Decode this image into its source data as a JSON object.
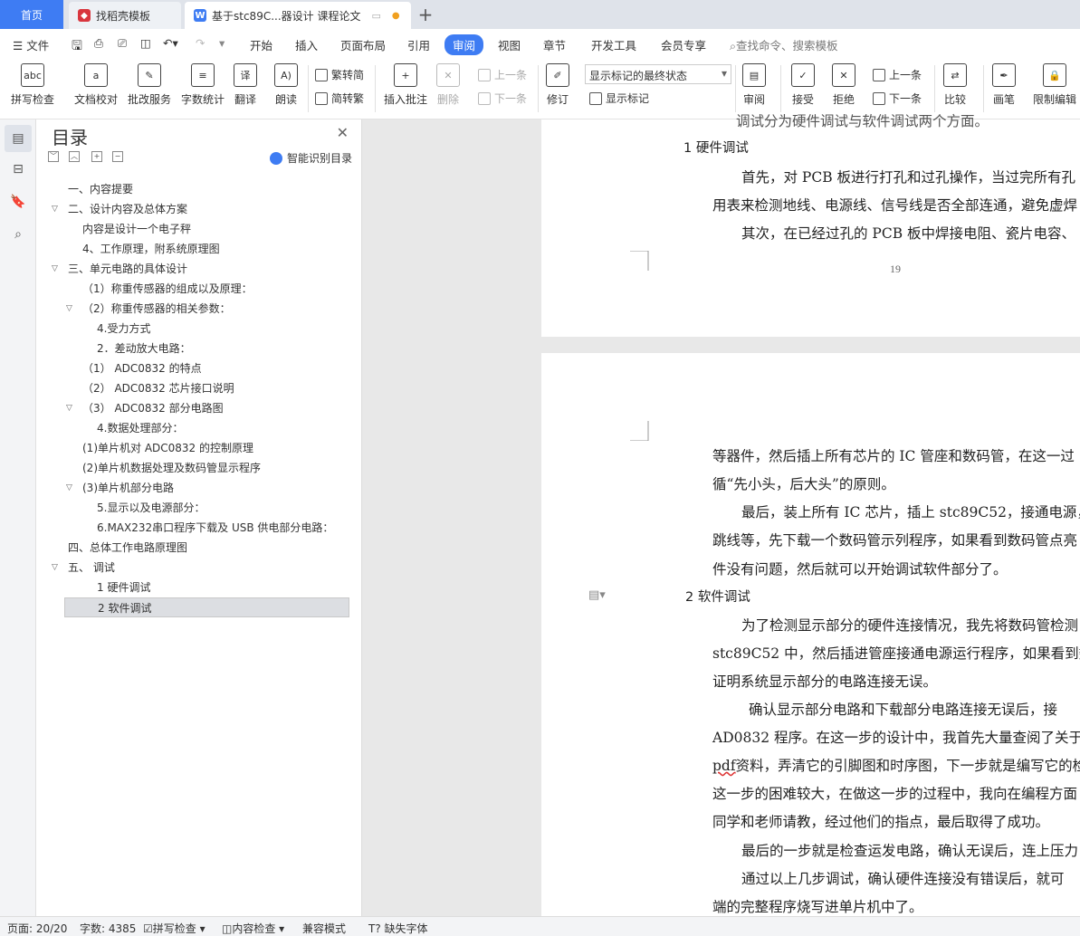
{
  "tabs": {
    "home": "首页",
    "template": "找稻壳模板",
    "doc": "基于stc89C...器设计 课程论文",
    "add": "+"
  },
  "menu": {
    "file": "文件",
    "items": [
      "开始",
      "插入",
      "页面布局",
      "引用",
      "审阅",
      "视图",
      "章节",
      "开发工具",
      "会员专享"
    ],
    "search": "查找命令、搜索模板"
  },
  "ribbon": {
    "spell": "拼写检查",
    "proof": "文档校对",
    "annotate_service": "批改服务",
    "wordcount": "字数统计",
    "translate": "翻译",
    "read": "朗读",
    "trad": "繁转简",
    "simp": "简转繁",
    "insert_comment": "插入批注",
    "delete": "删除",
    "prev_comment": "上一条",
    "next_comment": "下一条",
    "revise": "修订",
    "markup_state": "显示标记的最终状态",
    "show_markup": "显示标记",
    "review": "审阅",
    "accept": "接受",
    "reject": "拒绝",
    "prev_change": "上一条",
    "next_change": "下一条",
    "compare": "比较",
    "pen": "画笔",
    "restrict": "限制编辑"
  },
  "toc": {
    "title": "目录",
    "smart": "智能识别目录",
    "items": [
      {
        "text": "一、内容提要"
      },
      {
        "text": "二、设计内容及总体方案"
      },
      {
        "text": "内容是设计一个电子秤"
      },
      {
        "text": "4、工作原理，附系统原理图"
      },
      {
        "text": "三、单元电路的具体设计"
      },
      {
        "text": "（1）称重传感器的组成以及原理："
      },
      {
        "text": "（2）称重传感器的相关参数："
      },
      {
        "text": "4.受力方式"
      },
      {
        "text": "2．差动放大电路："
      },
      {
        "text": "（1） ADC0832 的特点"
      },
      {
        "text": "（2） ADC0832 芯片接口说明"
      },
      {
        "text": "（3） ADC0832 部分电路图"
      },
      {
        "text": "4.数据处理部分："
      },
      {
        "text": "(1)单片机对 ADC0832  的控制原理"
      },
      {
        "text": "(2)单片机数据处理及数码管显示程序"
      },
      {
        "text": "(3)单片机部分电路"
      },
      {
        "text": "5.显示以及电源部分："
      },
      {
        "text": "6.MAX232串口程序下载及 USB 供电部分电路："
      },
      {
        "text": "四、总体工作电路原理图"
      },
      {
        "text": "五、  调试"
      },
      {
        "text": "1  硬件调试"
      },
      {
        "text": "2  软件调试"
      }
    ]
  },
  "page1": {
    "top_line": "调试分为硬件调试与软件调试两个方面。",
    "heading": "1  硬件调试",
    "p1": "首先，对 PCB 板进行打孔和过孔操作，当过完所有孔",
    "p2": "用表来检测地线、电源线、信号线是否全部连通，避免虚焊",
    "p3": "其次，在已经过孔的 PCB 板中焊接电阻、瓷片电容、",
    "page_number": "19"
  },
  "page2": {
    "l1": "等器件，然后插上所有芯片的 IC 管座和数码管，在这一过",
    "l2": "循“先小头，后大头”的原则。",
    "l3": "最后，装上所有 IC 芯片，插上 stc89C52，接通电源，连",
    "l4": "跳线等，先下载一个数码管示列程序，如果看到数码管点亮",
    "l5": "件没有问题，然后就可以开始调试软件部分了。",
    "heading": "2  软件调试",
    "l6": "为了检测显示部分的硬件连接情况，我先将数码管检测",
    "l7": "stc89C52 中，然后插进管座接通电源运行程序，如果看到数",
    "l8": "证明系统显示部分的电路连接无误。",
    "l9": "确认显示部分电路和下载部分电路连接无误后，接",
    "l10": "AD0832 程序。在这一步的设计中，我首先大量查阅了关于",
    "l11a": "pdf",
    "l11b": "资料，弄清它的引脚图和时序图，下一步就是编写它的检",
    "l12": "这一步的困难较大，在做这一步的过程中，我向在编程方面",
    "l13": "同学和老师请教，经过他们的指点，最后取得了成功。",
    "l14": "最后的一步就是检查运发电路，确认无误后，连上压力",
    "l15": "通过以上几步调试，确认硬件连接没有错误后，就可",
    "l16": "端的完整程序烧写进单片机中了。"
  },
  "status": {
    "page": "页面: 20/20",
    "words": "字数: 4385",
    "spell": "拼写检查",
    "content": "内容检查",
    "compat": "兼容模式",
    "font": "缺失字体"
  },
  "colors": {
    "accent": "#3e7cf3"
  }
}
